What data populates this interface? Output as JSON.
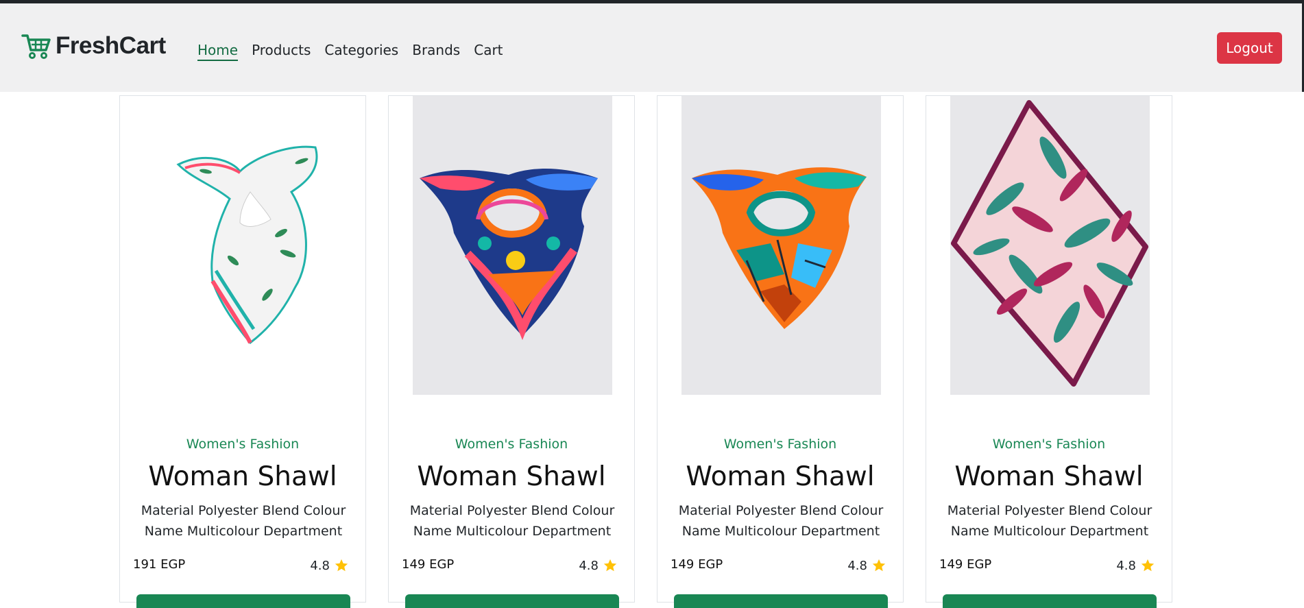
{
  "brand": {
    "name": "FreshCart",
    "color": "#198754"
  },
  "nav": {
    "items": [
      {
        "label": "Home",
        "active": true
      },
      {
        "label": "Products",
        "active": false
      },
      {
        "label": "Categories",
        "active": false
      },
      {
        "label": "Brands",
        "active": false
      },
      {
        "label": "Cart",
        "active": false
      }
    ],
    "logout_label": "Logout",
    "logout_color": "#dc3545"
  },
  "products": [
    {
      "category": "Women's Fashion",
      "title": "Woman Shawl",
      "description": "Material Polyester Blend Colour Name Multicolour Department",
      "price": "191 EGP",
      "rating": "4.8",
      "image": "white-teal-floral-scarf"
    },
    {
      "category": "Women's Fashion",
      "title": "Woman Shawl",
      "description": "Material Polyester Blend Colour Name Multicolour Department",
      "price": "149 EGP",
      "rating": "4.8",
      "image": "blue-pink-tied-scarf"
    },
    {
      "category": "Women's Fashion",
      "title": "Woman Shawl",
      "description": "Material Polyester Blend Colour Name Multicolour Department",
      "price": "149 EGP",
      "rating": "4.8",
      "image": "orange-teal-tied-scarf"
    },
    {
      "category": "Women's Fashion",
      "title": "Woman Shawl",
      "description": "Material Polyester Blend Colour Name Multicolour Department",
      "price": "149 EGP",
      "rating": "4.8",
      "image": "pink-leaf-square-scarf"
    }
  ],
  "icons": {
    "cart": "shopping-cart-icon",
    "star": "star-icon"
  },
  "colors": {
    "accent": "#198754",
    "star": "#ffc107",
    "navbar_bg": "#f0f0f1"
  }
}
